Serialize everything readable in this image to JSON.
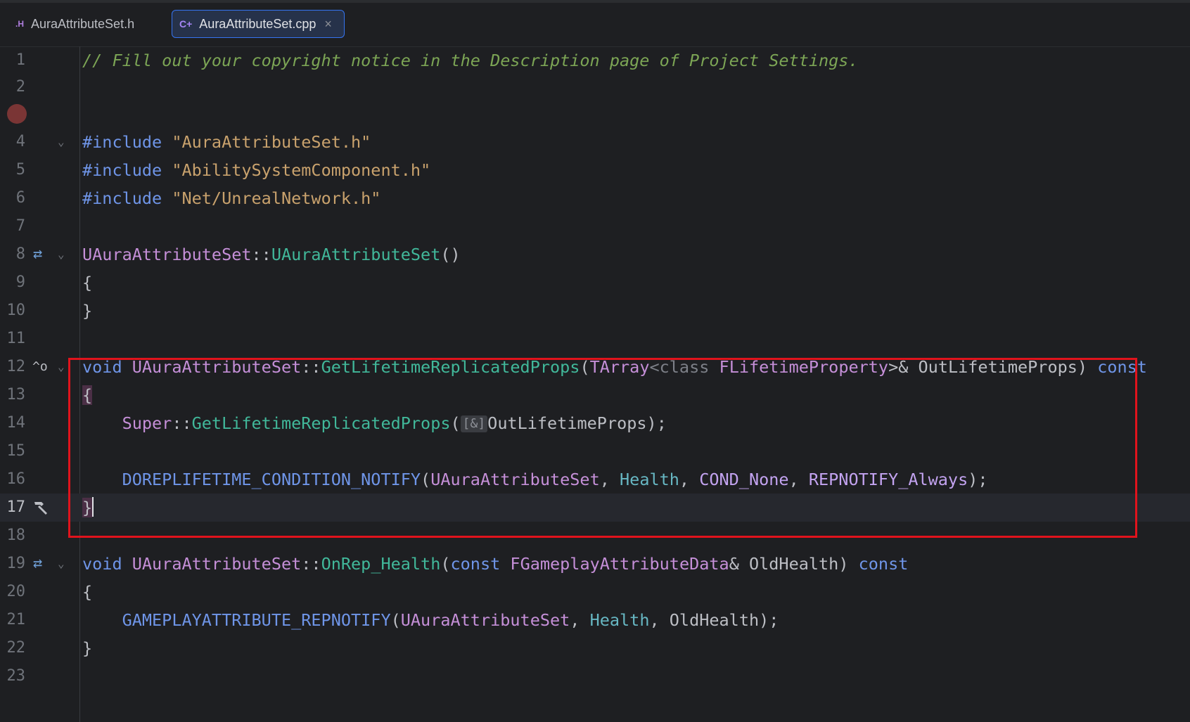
{
  "tabs": [
    {
      "icon": ".H",
      "label": "AuraAttributeSet.h",
      "active": false
    },
    {
      "icon": "C+",
      "label": "AuraAttributeSet.cpp",
      "active": true,
      "close": "×"
    }
  ],
  "gutter_icons": {
    "breakpoint": "breakpoint-icon",
    "implements": "⇄",
    "override": "^o",
    "build": "hammer-icon",
    "fold": "⌄"
  },
  "code": {
    "l1": "// Fill out your copyright notice in the Description page of Project Settings.",
    "inc_kw": "#include",
    "inc1": "\"AuraAttributeSet.h\"",
    "inc2": "\"AbilitySystemComponent.h\"",
    "inc3": "\"Net/UnrealNetwork.h\"",
    "cls": "UAuraAttributeSet",
    "ctor": "UAuraAttributeSet",
    "void": "void",
    "getprops": "GetLifetimeReplicatedProps",
    "tarray": "TArray",
    "class_kw": "class",
    "flp": "FLifetimeProperty",
    "outprops": "OutLifetimeProps",
    "const": "const",
    "super": "Super",
    "hint_ref": "[&]",
    "dorep": "DOREPLIFETIME_CONDITION_NOTIFY",
    "health": "Health",
    "cond": "COND_None",
    "repnotify": "REPNOTIFY_Always",
    "onrep": "OnRep_Health",
    "fgad": "FGameplayAttributeData",
    "oldhealth": "OldHealth",
    "garep": "GAMEPLAYATTRIBUTE_REPNOTIFY"
  },
  "line_numbers": [
    "1",
    "2",
    "3",
    "4",
    "5",
    "6",
    "7",
    "8",
    "9",
    "10",
    "11",
    "12",
    "13",
    "14",
    "15",
    "16",
    "17",
    "18",
    "19",
    "20",
    "21",
    "22",
    "23"
  ],
  "colors": {
    "highlight_box": "#e0131c",
    "accent": "#3574f0"
  }
}
